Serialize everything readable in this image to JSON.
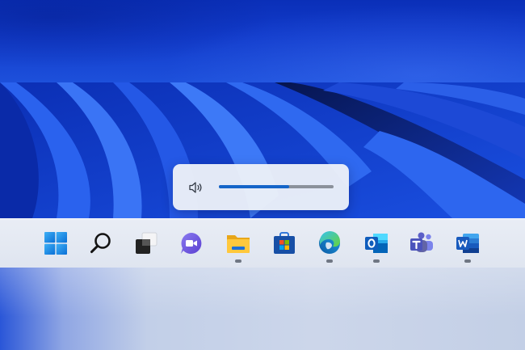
{
  "volume": {
    "level_percent": 61,
    "icon": "speaker-icon"
  },
  "taskbar": {
    "items": [
      {
        "name": "start",
        "icon": "windows-logo-icon",
        "running": false
      },
      {
        "name": "search",
        "icon": "search-icon",
        "running": false
      },
      {
        "name": "task-view",
        "icon": "task-view-icon",
        "running": false
      },
      {
        "name": "chat",
        "icon": "chat-video-icon",
        "running": false
      },
      {
        "name": "file-explorer",
        "icon": "folder-icon",
        "running": true
      },
      {
        "name": "microsoft-store",
        "icon": "store-icon",
        "running": false
      },
      {
        "name": "edge",
        "icon": "edge-icon",
        "running": true
      },
      {
        "name": "outlook",
        "icon": "outlook-icon",
        "running": true
      },
      {
        "name": "teams",
        "icon": "teams-icon",
        "running": false
      },
      {
        "name": "word",
        "icon": "word-icon",
        "running": true
      }
    ]
  },
  "colors": {
    "accent": "#1565c9",
    "wallpaper_blue": "#1242d6",
    "taskbar": "#e6eaf2"
  }
}
